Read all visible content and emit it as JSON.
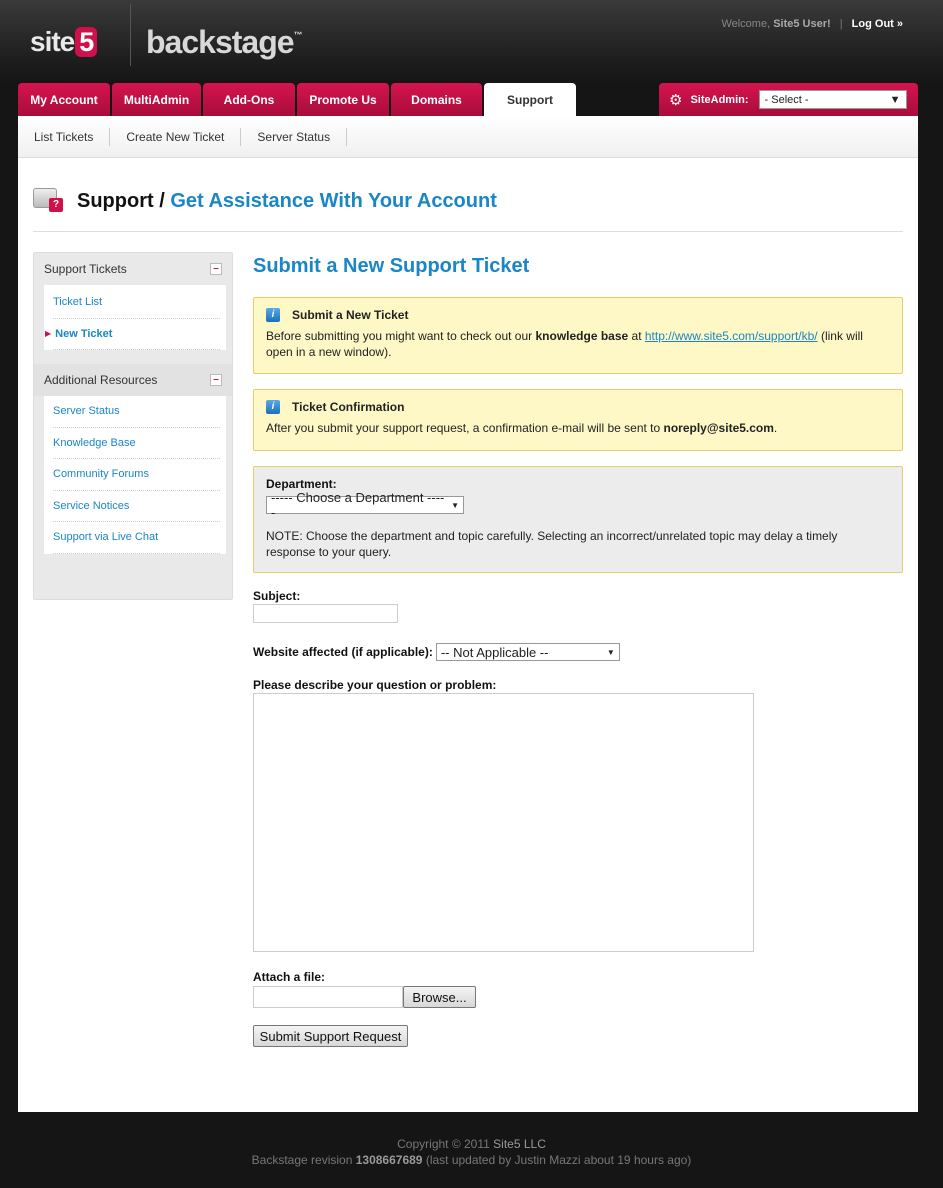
{
  "header": {
    "logo_site": "site",
    "logo_five": "5",
    "logo_backstage": "backstage",
    "logo_tm": "™",
    "welcome_prefix": "Welcome,",
    "welcome_user": "Site5 User!",
    "separator": "|",
    "logout": "Log Out »"
  },
  "tabs": [
    {
      "label": "My Account"
    },
    {
      "label": "MultiAdmin"
    },
    {
      "label": "Add-Ons"
    },
    {
      "label": "Promote Us"
    },
    {
      "label": "Domains"
    },
    {
      "label": "Support",
      "active": true
    }
  ],
  "siteadmin": {
    "icon": "gear-icon",
    "label": "SiteAdmin:",
    "selected": "- Select -"
  },
  "subnav": [
    "List Tickets",
    "Create New Ticket",
    "Server Status"
  ],
  "page": {
    "title": "Support /",
    "subtitle": "Get Assistance With Your Account"
  },
  "sidebar": {
    "groups": [
      {
        "title": "Support Tickets",
        "collapse": "–",
        "items": [
          "Ticket List",
          "New Ticket"
        ]
      },
      {
        "title": "Additional Resources",
        "collapse": "–",
        "items": [
          "Server Status",
          "Knowledge Base",
          "Community Forums",
          "Service Notices",
          "Support via Live Chat"
        ]
      }
    ]
  },
  "form": {
    "title": "Submit a New Support Ticket",
    "notice1": {
      "title": "Submit a New Ticket",
      "text_a": "Before submitting you might want to check out our ",
      "bold": "knowledge base",
      "text_b": " at ",
      "link": "http://www.site5.com/support/kb/",
      "text_c": " (link will open in a new window)."
    },
    "notice2": {
      "title": "Ticket Confirmation",
      "text_a": "After you submit your support request, a confirmation e-mail will be sent to ",
      "email": "noreply@site5.com",
      "text_b": "."
    },
    "department": {
      "label": "Department:",
      "selected": "----- Choose a Department -----",
      "note": "NOTE: Choose the department and topic carefully. Selecting an incorrect/unrelated topic may delay a timely response to your query."
    },
    "subject": {
      "label": "Subject:",
      "value": ""
    },
    "website": {
      "label": "Website affected (if applicable):",
      "selected": "-- Not Applicable --"
    },
    "description": {
      "label": "Please describe your question or problem:",
      "value": ""
    },
    "attach": {
      "label": "Attach a file:",
      "browse": "Browse..."
    },
    "submit": "Submit Support Request"
  },
  "footer": {
    "copyright": "Copyright © 2011 ",
    "company": "Site5 LLC",
    "revision_prefix": "Backstage revision ",
    "revision": "1308667689",
    "revision_suffix": " (last updated by Justin Mazzi about 19 hours ago)"
  },
  "colors": {
    "accent": "#d0104a",
    "link": "#1a86c6",
    "notice_bg": "#fdf8c6"
  }
}
